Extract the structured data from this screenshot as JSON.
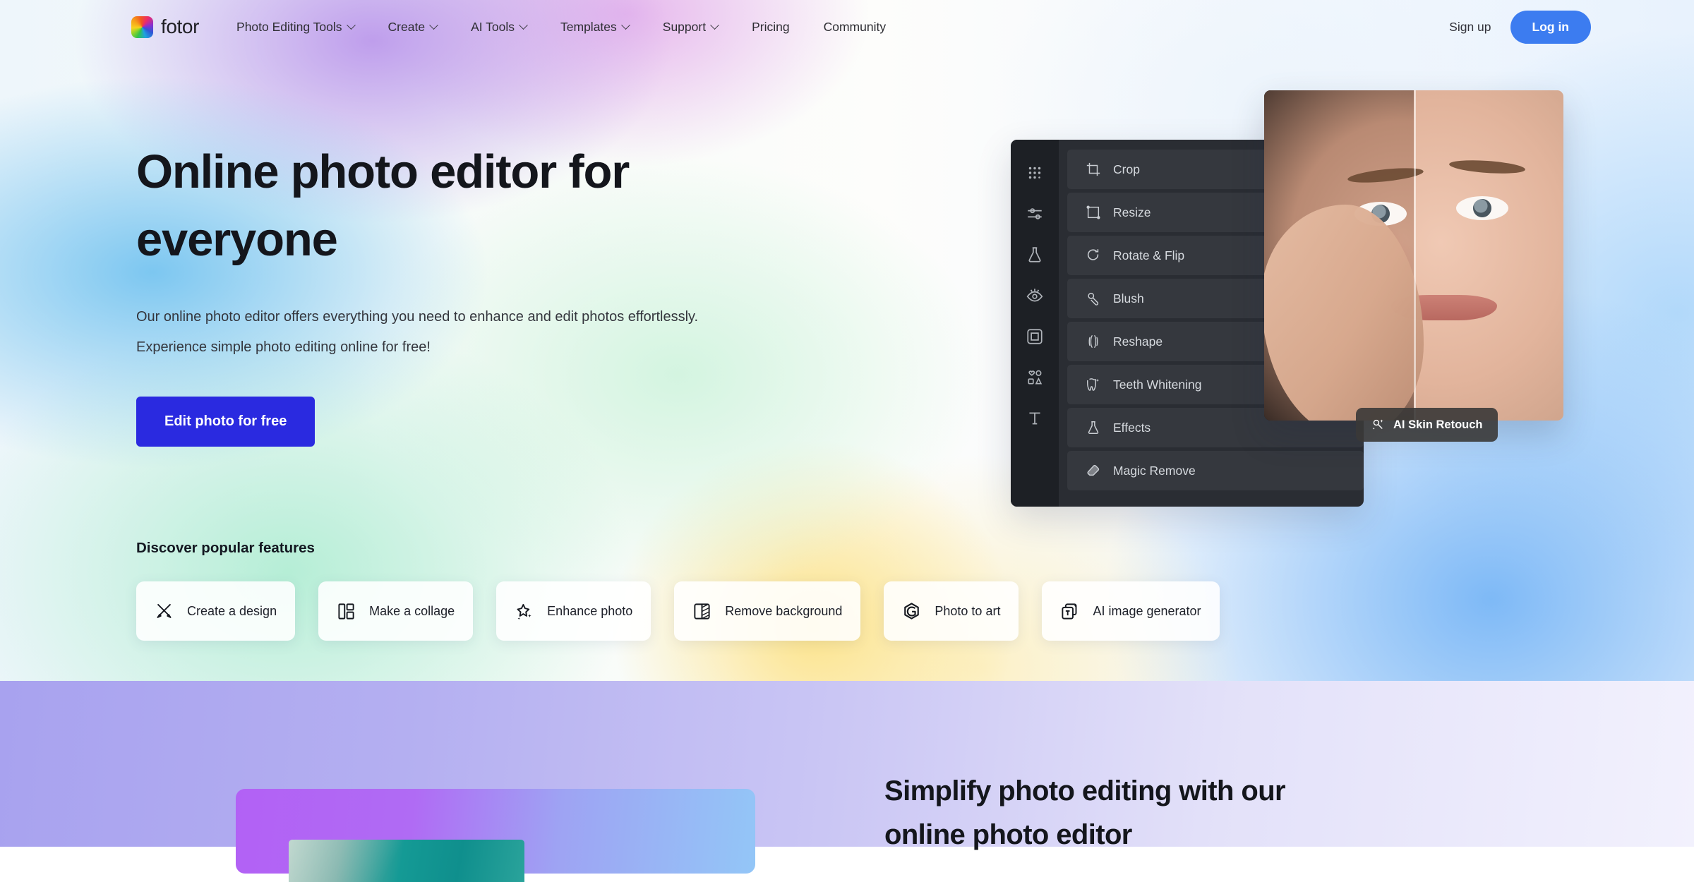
{
  "brand": {
    "name": "fotor",
    "logo_icon": "fotor-pinwheel-logo"
  },
  "nav": {
    "items": [
      {
        "label": "Photo Editing Tools",
        "has_dropdown": true
      },
      {
        "label": "Create",
        "has_dropdown": true
      },
      {
        "label": "AI Tools",
        "has_dropdown": true
      },
      {
        "label": "Templates",
        "has_dropdown": true
      },
      {
        "label": "Support",
        "has_dropdown": true
      },
      {
        "label": "Pricing",
        "has_dropdown": false
      },
      {
        "label": "Community",
        "has_dropdown": false
      }
    ],
    "signup_label": "Sign up",
    "login_label": "Log in",
    "login_color": "#3c7cf0"
  },
  "hero": {
    "title_line1": "Online photo editor for",
    "title_line2": "everyone",
    "subtitle_line1": "Our online photo editor offers everything you need to enhance and edit photos effortlessly.",
    "subtitle_line2": "Experience simple photo editing online for free!",
    "cta_label": "Edit photo for free",
    "cta_color": "#2a2ae0"
  },
  "editor_mock": {
    "rail_icons": [
      "apps-grid-icon",
      "adjust-sliders-icon",
      "flask-effects-icon",
      "eye-retouch-icon",
      "frame-icon",
      "shapes-icon",
      "text-tool-icon"
    ],
    "tools": [
      {
        "label": "Crop",
        "icon": "crop-icon"
      },
      {
        "label": "Resize",
        "icon": "resize-icon"
      },
      {
        "label": "Rotate & Flip",
        "icon": "rotate-icon"
      },
      {
        "label": "Blush",
        "icon": "blush-icon"
      },
      {
        "label": "Reshape",
        "icon": "reshape-icon"
      },
      {
        "label": "Teeth Whitening",
        "icon": "tooth-icon"
      },
      {
        "label": "Effects",
        "icon": "effects-flask-icon"
      },
      {
        "label": "Magic Remove",
        "icon": "eraser-icon"
      }
    ],
    "tooltip_label": "AI Skin Retouch",
    "tooltip_icon": "ai-sparkle-icon"
  },
  "features": {
    "title": "Discover popular features",
    "cards": [
      {
        "label": "Create a design",
        "icon": "crossed-tools-icon"
      },
      {
        "label": "Make a collage",
        "icon": "collage-grid-icon"
      },
      {
        "label": "Enhance photo",
        "icon": "sparkle-star-icon"
      },
      {
        "label": "Remove background",
        "icon": "remove-bg-icon"
      },
      {
        "label": "Photo to art",
        "icon": "photo-to-art-icon"
      },
      {
        "label": "AI image generator",
        "icon": "ai-image-stack-icon"
      }
    ]
  },
  "promo": {
    "heading_line1": "Simplify photo editing with our",
    "heading_line2": "online photo editor"
  }
}
